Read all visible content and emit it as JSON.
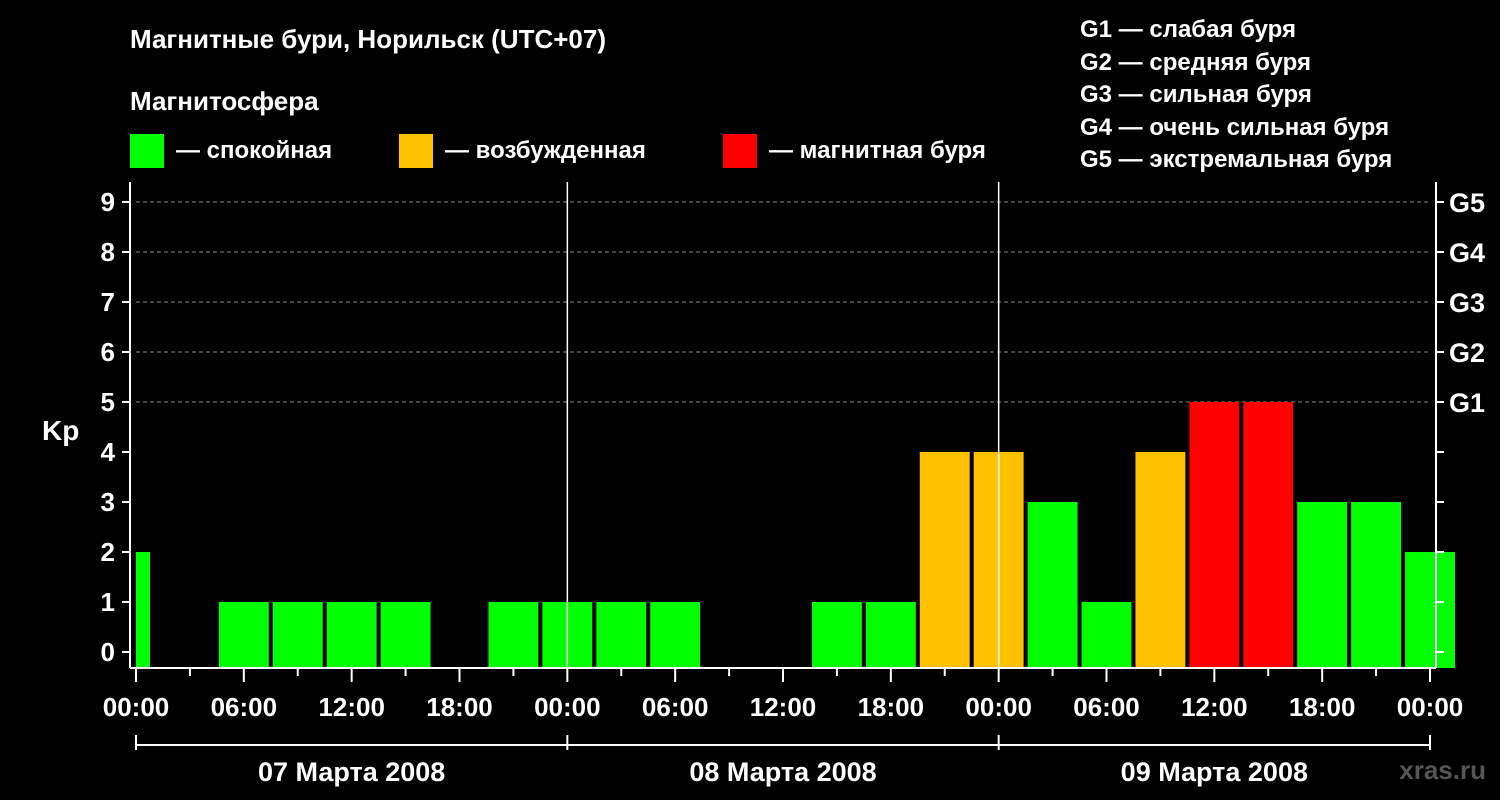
{
  "title": "Магнитные бури, Норильск (UTC+07)",
  "subtitle": "Магнитосфера",
  "legend": [
    {
      "label": "— спокойная",
      "color": "#00ff00"
    },
    {
      "label": "— возбужденная",
      "color": "#ffc000"
    },
    {
      "label": "— магнитная буря",
      "color": "#ff0000"
    }
  ],
  "g_scale": [
    "G1 — слабая буря",
    "G2 — средняя буря",
    "G3 — сильная буря",
    "G4 — очень сильная буря",
    "G5 — экстремальная буря"
  ],
  "watermark": "xras.ru",
  "chart_data": {
    "type": "bar",
    "ylabel": "Kp",
    "ylim": [
      0,
      9
    ],
    "y_ticks": [
      "0",
      "1",
      "2",
      "3",
      "4",
      "5",
      "6",
      "7",
      "8",
      "9"
    ],
    "right_ticks": [
      {
        "value": 5,
        "label": "G1"
      },
      {
        "value": 6,
        "label": "G2"
      },
      {
        "value": 7,
        "label": "G3"
      },
      {
        "value": 8,
        "label": "G4"
      },
      {
        "value": 9,
        "label": "G5"
      }
    ],
    "x_tick_labels": [
      "00:00",
      "06:00",
      "12:00",
      "18:00",
      "00:00",
      "06:00",
      "12:00",
      "18:00",
      "00:00",
      "06:00",
      "12:00",
      "18:00",
      "00:00"
    ],
    "days": [
      "07 Марта 2008",
      "08 Марта 2008",
      "09 Марта 2008"
    ],
    "grid": "dashed horizontal at Kp 5–9",
    "series": [
      {
        "values": [
          2,
          0,
          1,
          1,
          1,
          1,
          0,
          1,
          1,
          1,
          1,
          0,
          0,
          1,
          1,
          4,
          4,
          3,
          1,
          4,
          5,
          5,
          3,
          3,
          2
        ]
      }
    ],
    "colors": {
      "calm": "#00ff00",
      "disturbed": "#ffc000",
      "storm": "#ff0000"
    }
  }
}
